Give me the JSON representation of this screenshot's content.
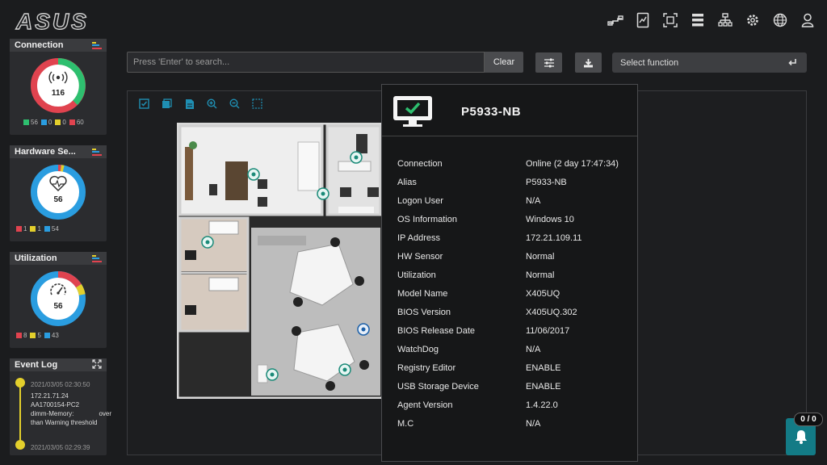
{
  "brand": {
    "logo_text": "ASUS"
  },
  "header": {
    "icons": [
      "link-icon",
      "report-icon",
      "scan-icon",
      "list-icon",
      "sitemap-icon",
      "settings-icon",
      "globe-icon",
      "user-icon"
    ]
  },
  "sidebar": {
    "connection": {
      "title": "Connection",
      "total": "116",
      "legend": [
        {
          "color": "#2ebf6f",
          "value": "56"
        },
        {
          "color": "#2a9de0",
          "value": "0"
        },
        {
          "color": "#e3cf2c",
          "value": "0"
        },
        {
          "color": "#e0434f",
          "value": "60"
        }
      ]
    },
    "hardware": {
      "title": "Hardware Se...",
      "total": "56",
      "legend": [
        {
          "color": "#e0434f",
          "value": "1"
        },
        {
          "color": "#e3cf2c",
          "value": "1"
        },
        {
          "color": "#2a9de0",
          "value": "54"
        }
      ]
    },
    "utilization": {
      "title": "Utilization",
      "total": "56",
      "legend": [
        {
          "color": "#e0434f",
          "value": "8"
        },
        {
          "color": "#e3cf2c",
          "value": "5"
        },
        {
          "color": "#2a9de0",
          "value": "43"
        }
      ]
    },
    "event_log": {
      "title": "Event Log",
      "entries": [
        {
          "time": "2021/03/05 02:30:50",
          "lines": [
            "172.21.71.24",
            "AA1700154-PC2"
          ],
          "desc_left": "dimm-Memory:",
          "desc_right": "over",
          "desc_line2": "than Warning threshold"
        },
        {
          "time": "2021/03/05 02:29:39"
        }
      ]
    }
  },
  "toolbar": {
    "search_placeholder": "Press 'Enter' to search...",
    "clear_label": "Clear",
    "select_function_label": "Select function"
  },
  "device": {
    "name": "P5933-NB",
    "status_color": "#2ebf6f",
    "fields": [
      {
        "label": "Connection",
        "value": "Online (2 day 17:47:34)"
      },
      {
        "label": "Alias",
        "value": "P5933-NB"
      },
      {
        "label": "Logon User",
        "value": "N/A"
      },
      {
        "label": "OS Information",
        "value": "Windows 10"
      },
      {
        "label": "IP Address",
        "value": "172.21.109.11"
      },
      {
        "label": "HW Sensor",
        "value": "Normal"
      },
      {
        "label": "Utilization",
        "value": "Normal"
      },
      {
        "label": "Model Name",
        "value": "X405UQ"
      },
      {
        "label": "BIOS Version",
        "value": "X405UQ.302"
      },
      {
        "label": "BIOS Release Date",
        "value": "11/06/2017"
      },
      {
        "label": "WatchDog",
        "value": "N/A"
      },
      {
        "label": "Registry Editor",
        "value": "ENABLE"
      },
      {
        "label": "USB Storage Device",
        "value": "ENABLE"
      },
      {
        "label": "Agent Version",
        "value": "1.4.22.0"
      },
      {
        "label": "M.C",
        "value": "N/A"
      }
    ]
  },
  "notifications": {
    "count": "0 / 0"
  }
}
